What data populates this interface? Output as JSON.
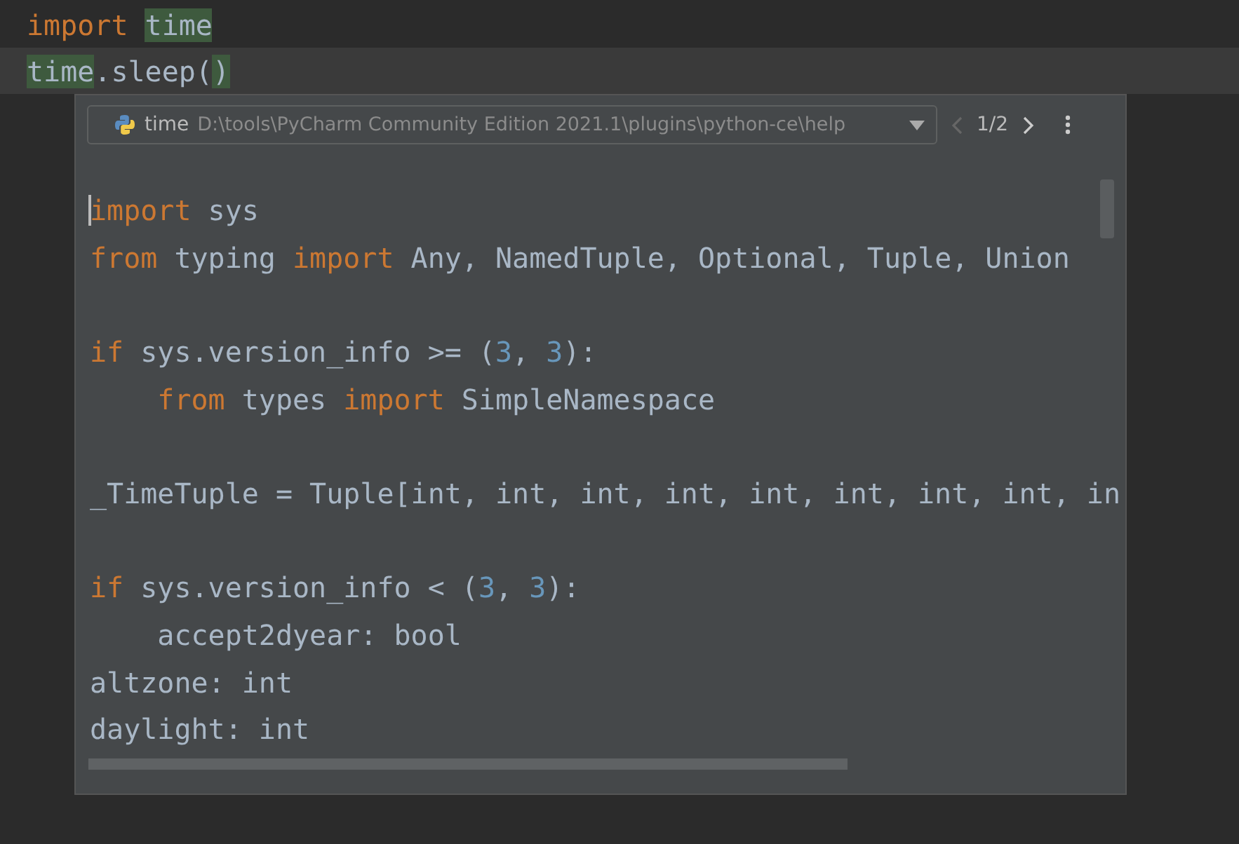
{
  "editor": {
    "lines": [
      {
        "current": false,
        "tokens": [
          {
            "kind": "keyword",
            "text": "import ",
            "highlighted": false
          },
          {
            "kind": "plain",
            "text": "time",
            "highlighted": true
          }
        ]
      },
      {
        "current": true,
        "tokens": [
          {
            "kind": "plain",
            "text": "time",
            "highlighted": true
          },
          {
            "kind": "plain",
            "text": ".sleep(",
            "highlighted": false
          },
          {
            "kind": "plain",
            "text": ")",
            "highlighted": true
          }
        ]
      }
    ]
  },
  "popup": {
    "module": "time",
    "path": "D:\\tools\\PyCharm Community Edition 2021.1\\plugins\\python-ce\\help",
    "page": "1/2",
    "lines": [
      {
        "kind": "code",
        "tokens": [
          {
            "kind": "keyword",
            "text": "import"
          },
          {
            "kind": "plain",
            "text": " sys"
          }
        ]
      },
      {
        "kind": "code",
        "tokens": [
          {
            "kind": "keyword",
            "text": "from"
          },
          {
            "kind": "plain",
            "text": " typing "
          },
          {
            "kind": "keyword",
            "text": "import"
          },
          {
            "kind": "plain",
            "text": " Any, NamedTuple, Optional, Tuple, Union"
          }
        ]
      },
      {
        "kind": "blank"
      },
      {
        "kind": "code",
        "tokens": [
          {
            "kind": "keyword",
            "text": "if"
          },
          {
            "kind": "plain",
            "text": " sys.version_info >= ("
          },
          {
            "kind": "number",
            "text": "3"
          },
          {
            "kind": "plain",
            "text": ", "
          },
          {
            "kind": "number",
            "text": "3"
          },
          {
            "kind": "plain",
            "text": "):"
          }
        ]
      },
      {
        "kind": "code",
        "tokens": [
          {
            "kind": "keyword",
            "text": "    from"
          },
          {
            "kind": "plain",
            "text": " types "
          },
          {
            "kind": "keyword",
            "text": "import"
          },
          {
            "kind": "plain",
            "text": " SimpleNamespace"
          }
        ]
      },
      {
        "kind": "blank"
      },
      {
        "kind": "code",
        "tokens": [
          {
            "kind": "plain",
            "text": "_TimeTuple = Tuple[int, int, int, int, int, int, int, int, in"
          }
        ]
      },
      {
        "kind": "blank"
      },
      {
        "kind": "code",
        "tokens": [
          {
            "kind": "keyword",
            "text": "if"
          },
          {
            "kind": "plain",
            "text": " sys.version_info < ("
          },
          {
            "kind": "number",
            "text": "3"
          },
          {
            "kind": "plain",
            "text": ", "
          },
          {
            "kind": "number",
            "text": "3"
          },
          {
            "kind": "plain",
            "text": "):"
          }
        ]
      },
      {
        "kind": "code",
        "tokens": [
          {
            "kind": "plain",
            "text": "    accept2dyear: bool"
          }
        ]
      },
      {
        "kind": "code",
        "tokens": [
          {
            "kind": "plain",
            "text": "altzone: int"
          }
        ]
      },
      {
        "kind": "code",
        "tokens": [
          {
            "kind": "plain",
            "text": "daylight: int"
          }
        ]
      }
    ]
  }
}
